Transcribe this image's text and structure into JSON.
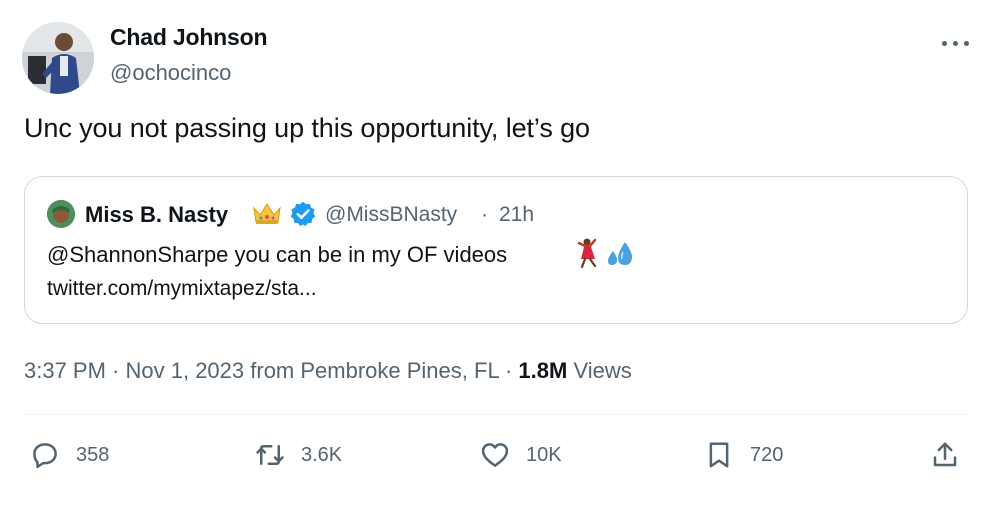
{
  "author": {
    "name": "Chad Johnson",
    "handle": "@ochocinco",
    "avatar_icon": "profile-photo"
  },
  "tweet_text": "Unc you not passing up this opportunity, let’s go",
  "quoted": {
    "name": "Miss B. Nasty",
    "crown_icon": "crown-emoji",
    "verified_icon": "verified-badge-icon",
    "handle": "@MissBNasty",
    "separator": "·",
    "time": "21h",
    "text": "@ShannonSharpe you can be in my OF videos",
    "emojis": [
      "dancer-emoji",
      "sweat-droplets-emoji"
    ],
    "link": "twitter.com/mymixtapez/sta..."
  },
  "meta": {
    "time": "3:37 PM",
    "sep1": " · ",
    "date": "Nov 1, 2023",
    "source": " from Pembroke Pines, FL",
    "sep2": " · ",
    "views_count": "1.8M",
    "views_label": " Views"
  },
  "actions": {
    "replies": "358",
    "retweets": "3.6K",
    "likes": "10K",
    "bookmarks": "720"
  },
  "colors": {
    "text": "#0f1419",
    "secondary": "#536471",
    "border": "#cfd9de",
    "verified": "#1d9bf0"
  }
}
